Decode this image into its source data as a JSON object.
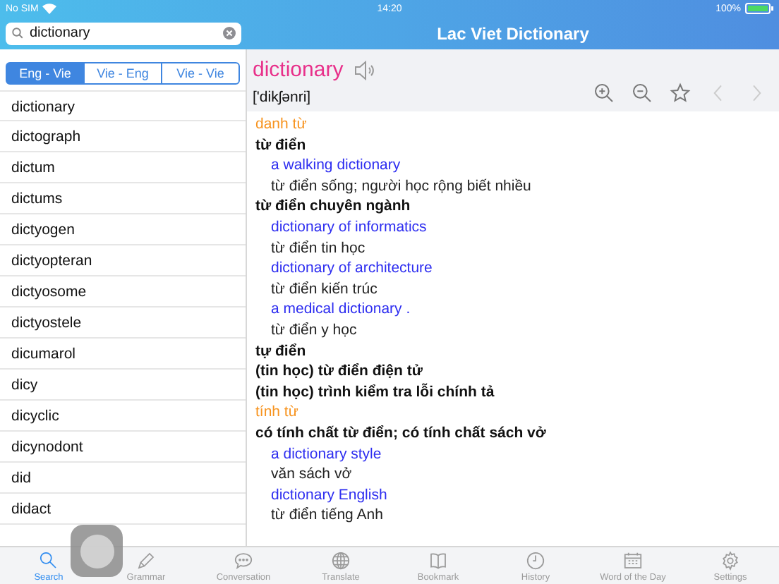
{
  "status_bar": {
    "carrier": "No SIM",
    "time": "14:20",
    "battery": "100%"
  },
  "search": {
    "value": "dictionary"
  },
  "title": "Lac Viet Dictionary",
  "direction_tabs": [
    {
      "label": "Eng - Vie",
      "selected": true
    },
    {
      "label": "Vie - Eng",
      "selected": false
    },
    {
      "label": "Vie - Vie",
      "selected": false
    }
  ],
  "word_list": [
    {
      "text": "dictionary"
    },
    {
      "text": "dictograph"
    },
    {
      "text": "dictum"
    },
    {
      "text": "dictums"
    },
    {
      "text": "dictyogen"
    },
    {
      "text": "dictyopteran"
    },
    {
      "text": "dictyosome"
    },
    {
      "text": "dictyostele"
    },
    {
      "text": "dicumarol"
    },
    {
      "text": "dicy"
    },
    {
      "text": "dicyclic"
    },
    {
      "text": "dicynodont"
    },
    {
      "text": "did"
    },
    {
      "text": "didact"
    }
  ],
  "entry": {
    "headword": "dictionary",
    "pronunciation": "['dikʃənri]",
    "lines": [
      {
        "kind": "pos",
        "text": "danh từ"
      },
      {
        "kind": "sense",
        "text": "từ điển"
      },
      {
        "kind": "example",
        "text": "a walking dictionary"
      },
      {
        "kind": "translation",
        "text": "từ điển sống; người học rộng biết nhiều"
      },
      {
        "kind": "sense",
        "text": "từ điển chuyên ngành"
      },
      {
        "kind": "example",
        "text": "dictionary of informatics"
      },
      {
        "kind": "translation",
        "text": "từ điển tin học"
      },
      {
        "kind": "example",
        "text": "dictionary of architecture"
      },
      {
        "kind": "translation",
        "text": "từ điển kiến trúc"
      },
      {
        "kind": "example",
        "text": "a medical dictionary ."
      },
      {
        "kind": "translation",
        "text": "từ điển y học"
      },
      {
        "kind": "sense",
        "text": "tự điển"
      },
      {
        "kind": "sense",
        "text": "(tin học) từ điển điện tử"
      },
      {
        "kind": "sense",
        "text": "(tin học) trình kiểm tra lỗi chính tả"
      },
      {
        "kind": "pos",
        "text": "tính từ"
      },
      {
        "kind": "sense",
        "text": "có tính chất từ điển; có tính chất sách vở"
      },
      {
        "kind": "example",
        "text": "a dictionary style"
      },
      {
        "kind": "translation",
        "text": "văn sách vở"
      },
      {
        "kind": "example",
        "text": "dictionary English"
      },
      {
        "kind": "translation",
        "text": "từ điển tiếng Anh"
      }
    ]
  },
  "tab_bar": [
    {
      "label": "Search",
      "selected": true
    },
    {
      "label": "Grammar",
      "selected": false
    },
    {
      "label": "Conversation",
      "selected": false
    },
    {
      "label": "Translate",
      "selected": false
    },
    {
      "label": "Bookmark",
      "selected": false
    },
    {
      "label": "History",
      "selected": false
    },
    {
      "label": "Word of the Day",
      "selected": false
    },
    {
      "label": "Settings",
      "selected": false
    }
  ]
}
